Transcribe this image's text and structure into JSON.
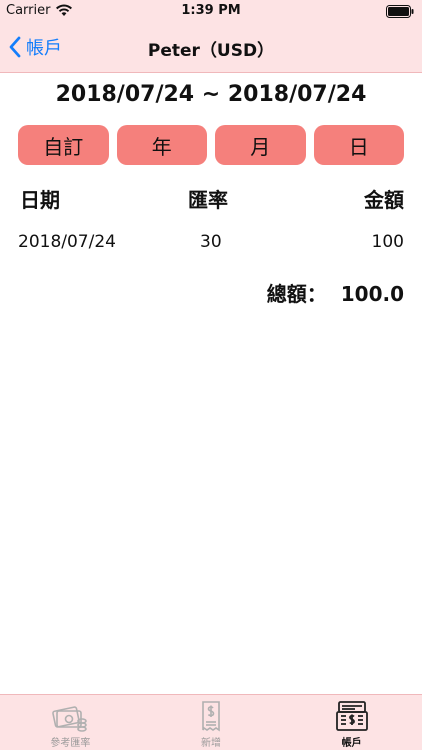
{
  "status_bar": {
    "carrier": "Carrier",
    "time": "1:39 PM"
  },
  "nav": {
    "back_label": "帳戶",
    "title": "Peter（USD）"
  },
  "date_range": "2018/07/24 ~ 2018/07/24",
  "periods": [
    {
      "label": "自訂"
    },
    {
      "label": "年"
    },
    {
      "label": "月"
    },
    {
      "label": "日"
    }
  ],
  "table": {
    "headers": {
      "date": "日期",
      "rate": "匯率",
      "amount": "金額"
    },
    "rows": [
      {
        "date": "2018/07/24",
        "rate": "30",
        "amount": "100"
      }
    ]
  },
  "total": {
    "label": "總額：",
    "value": "100.0"
  },
  "tabs": [
    {
      "label": "參考匯率",
      "icon": "currency-notes-icon",
      "active": false
    },
    {
      "label": "新增",
      "icon": "receipt-icon",
      "active": false
    },
    {
      "label": "帳戶",
      "icon": "ledger-register-icon",
      "active": true
    }
  ],
  "colors": {
    "header_bg": "#fde3e4",
    "period_button": "#f5807c",
    "link_blue": "#157efb"
  }
}
